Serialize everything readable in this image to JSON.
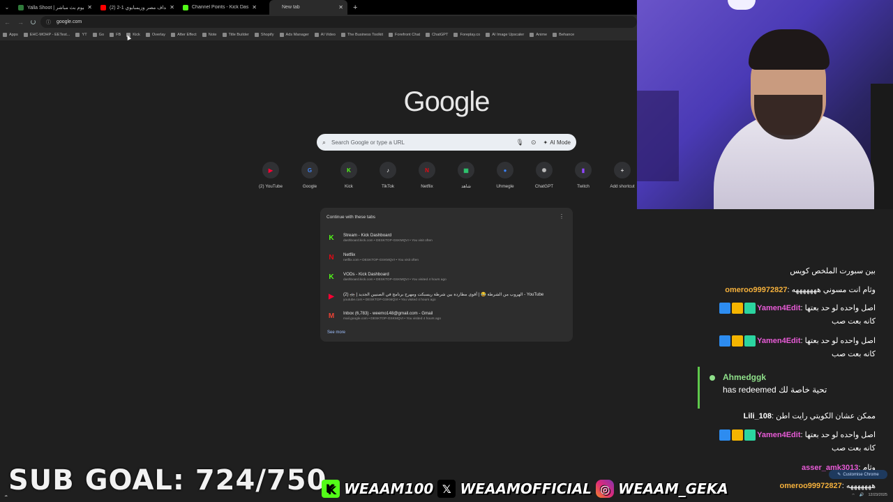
{
  "tabs": [
    {
      "title": "Yalla Shoot | يلا شوت اليوم بث مباشر",
      "fav_color": "#2f7a3a"
    },
    {
      "title": "(2) اهداف مصر وزيمبابوي 1-2",
      "fav_color": "#ff0000"
    },
    {
      "title": "Channel Points - Kick Dashboard",
      "fav_color": "#53fc18"
    },
    {
      "title": "New tab",
      "fav_color": "#555555",
      "active": true
    }
  ],
  "address": "google.com",
  "bookmarks": [
    "Apps",
    "EHC-MOHP - EETest...",
    "YT",
    "Go",
    "FB",
    "Kick",
    "Overlay",
    "After Effect",
    "Note",
    "Title Builder",
    "Shopify",
    "Ads Manager",
    "AI Video",
    "The Business Toolkit",
    "Forefront Chat",
    "ChatGPT",
    "Foreplay.co",
    "AI Image Upscaler",
    "Anime",
    "Behance"
  ],
  "ntp": {
    "logo": "Google",
    "search_placeholder": "Search Google or type a URL",
    "ai_mode": "AI Mode",
    "shortcuts": [
      {
        "label": "(2) YouTube",
        "icon": "youtube-icon",
        "color": "#ff0033",
        "glyph": "▶"
      },
      {
        "label": "Google",
        "icon": "google-icon",
        "color": "#4285f4",
        "glyph": "G"
      },
      {
        "label": "Kick",
        "icon": "kick-icon",
        "color": "#53fc18",
        "glyph": "K"
      },
      {
        "label": "TikTok",
        "icon": "tiktok-icon",
        "color": "#ffffff",
        "glyph": "♪"
      },
      {
        "label": "Netflix",
        "icon": "netflix-icon",
        "color": "#e50914",
        "glyph": "N"
      },
      {
        "label": "شاهد",
        "icon": "shahid-icon",
        "color": "#2ecc71",
        "glyph": "▦"
      },
      {
        "label": "Uhmegle",
        "icon": "uhmegle-icon",
        "color": "#3b82f6",
        "glyph": "●"
      },
      {
        "label": "ChatGPT",
        "icon": "chatgpt-icon",
        "color": "#bbbbbb",
        "glyph": "✺"
      },
      {
        "label": "Twitch",
        "icon": "twitch-icon",
        "color": "#9146ff",
        "glyph": "▮"
      },
      {
        "label": "Add shortcut",
        "icon": "plus-icon",
        "color": "#dddddd",
        "glyph": "+"
      }
    ],
    "continue": {
      "header": "Continue with these tabs",
      "items": [
        {
          "title": "Stream - Kick Dashboard",
          "sub": "dashboard.kick.com • DESKTOP-GSKMQVI • You visit often",
          "icon": "kick-icon",
          "color": "#53fc18",
          "glyph": "K"
        },
        {
          "title": "Netflix",
          "sub": "netflix.com • DESKTOP-GSKMQVI • You visit often",
          "icon": "netflix-icon",
          "color": "#e50914",
          "glyph": "N"
        },
        {
          "title": "VODs - Kick Dashboard",
          "sub": "dashboard.kick.com • DESKTOP-GSKMQVI • You visited 4 hours ago",
          "icon": "kick-icon",
          "color": "#53fc18",
          "glyph": "K"
        },
        {
          "title": "(2) 🚓 | الهروب من الشرطة 😂 | أقوى مطاردة بين شرطة ريسبكت ومهرج برنامج في الصنيين الجديد - YouTube",
          "sub": "youtube.com • DESKTOP-GSKMQVI • You visited 4 hours ago",
          "icon": "youtube-icon",
          "color": "#ff0033",
          "glyph": "▶"
        },
        {
          "title": "Inbox (6,783) - weemo148@gmail.com - Gmail",
          "sub": "mail.google.com • DESKTOP-GSKMQVI • You visited 4 hours ago",
          "icon": "gmail-icon",
          "color": "#ea4335",
          "glyph": "M"
        }
      ],
      "see_more": "See more"
    },
    "customise": "Customise Chrome"
  },
  "chat": [
    {
      "user": "",
      "text": "بين سبورت الملخص كويس",
      "badges": 0
    },
    {
      "user": "omeroo99972827",
      "text": ": وثام انت مسوني هههههههه",
      "color": "gold",
      "badges": 0
    },
    {
      "user": "Yamen4Edit",
      "text": ": اصل واحده لو حد بعتها",
      "color": "pink",
      "badges": 3,
      "cont": "كانه بعت صب"
    },
    {
      "user": "Yamen4Edit",
      "text": ": اصل واحده لو حد بعتها",
      "color": "pink",
      "badges": 3,
      "cont": "كانه بعت صب"
    },
    {
      "user": "Lili_108",
      "text": ": ممكن عشان الكويتي رايت اطن",
      "color": "plain",
      "badges": 0
    },
    {
      "user": "Yamen4Edit",
      "text": ": اصل واحده لو حد بعتها",
      "color": "pink",
      "badges": 3,
      "cont": "كانه بعت صب"
    },
    {
      "user": "asser_amk3013",
      "text": ": وثام",
      "color": "pink",
      "badges": 0
    },
    {
      "user": "omeroo99972827",
      "text": ": هههههههه",
      "color": "gold",
      "badges": 0
    }
  ],
  "redeem": {
    "user": "Ahmedggk",
    "text": "has redeemed تحية خاصة لك"
  },
  "overlay": {
    "sub_goal": "SUB GOAL: 724/750",
    "kick": "WEAAM100",
    "x": "WEAAMOFFICIAL",
    "instagram": "WEAAM_GEKA"
  },
  "tray": {
    "date": "12/23/2025"
  }
}
